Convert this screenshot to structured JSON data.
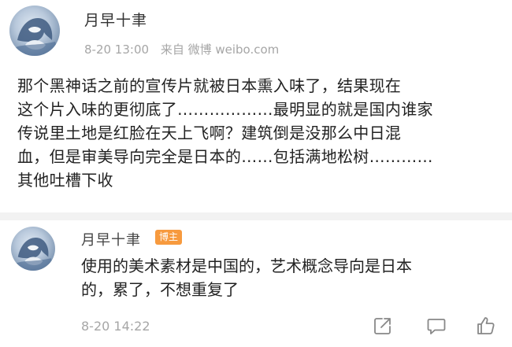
{
  "post": {
    "username": "月早十聿",
    "time": "8-20 13:00",
    "source": "来自 微博 weibo.com",
    "body_lines": [
      "那个黑神话之前的宣传片就被日本熏入味了，结果现在",
      "这个片入味的更彻底了………………最明显的就是国内谁家",
      "传说里土地是红脸在天上飞啊？建筑倒是没那么中日混",
      "血，但是审美导向完全是日本的……包括满地松树…………",
      "其他吐槽下收"
    ]
  },
  "comment": {
    "username": "月早十聿",
    "badge": "博主",
    "body_lines": [
      "使用的美术素材是中国的，艺术概念导向是日本",
      "的，累了，不想重复了"
    ],
    "time": "8-20 14:22"
  },
  "icons": {
    "share": "share-icon",
    "comment": "comment-icon",
    "like": "thumbs-up-icon"
  },
  "colors": {
    "badge": "#f79a3e",
    "meta_text": "#a6a6a6",
    "body_text": "#222222"
  }
}
